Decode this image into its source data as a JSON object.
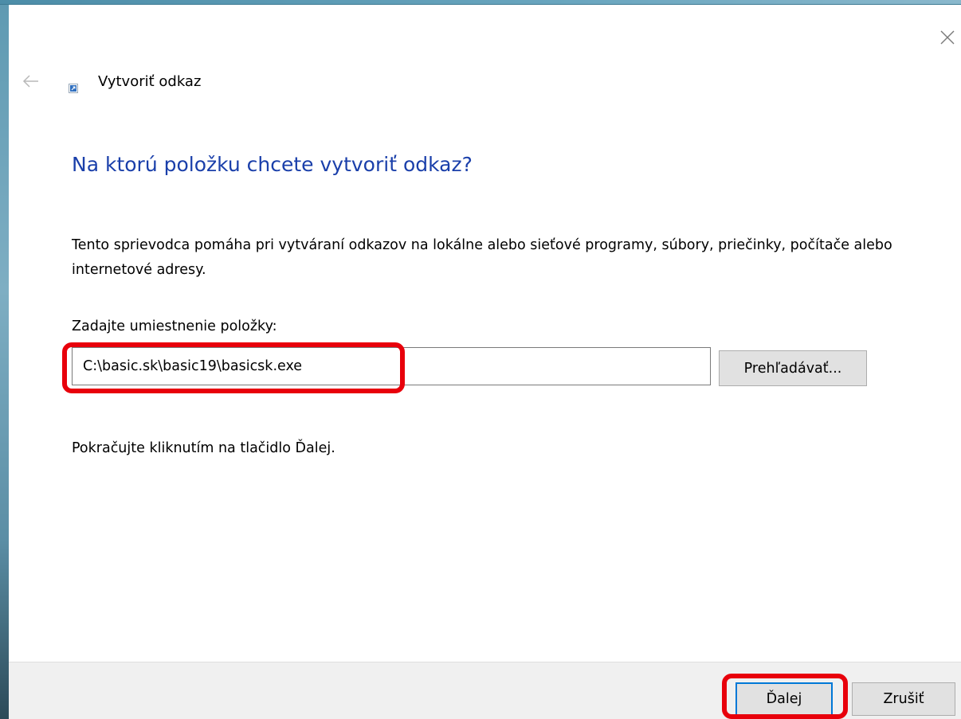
{
  "window": {
    "title": "Vytvoriť odkaz",
    "close_icon": "close-icon",
    "back_icon": "back-arrow-icon",
    "title_icon": "shortcut-icon"
  },
  "content": {
    "heading": "Na ktorú položku chcete vytvoriť odkaz?",
    "description": "Tento sprievodca pomáha pri vytváraní odkazov na lokálne alebo sieťové programy, súbory, priečinky, počítače alebo internetové adresy.",
    "input_label": "Zadajte umiestnenie položky:",
    "input_value": "C:\\basic.sk\\basic19\\basicsk.exe",
    "browse_label": "Prehľadávať...",
    "hint": "Pokračujte kliknutím na tlačidlo Ďalej."
  },
  "footer": {
    "next_label": "Ďalej",
    "cancel_label": "Zrušiť"
  },
  "colors": {
    "heading": "#1a3faa",
    "highlight": "#e8000b",
    "focus_border": "#0078d7",
    "footer_bg": "#f0f0f0"
  }
}
